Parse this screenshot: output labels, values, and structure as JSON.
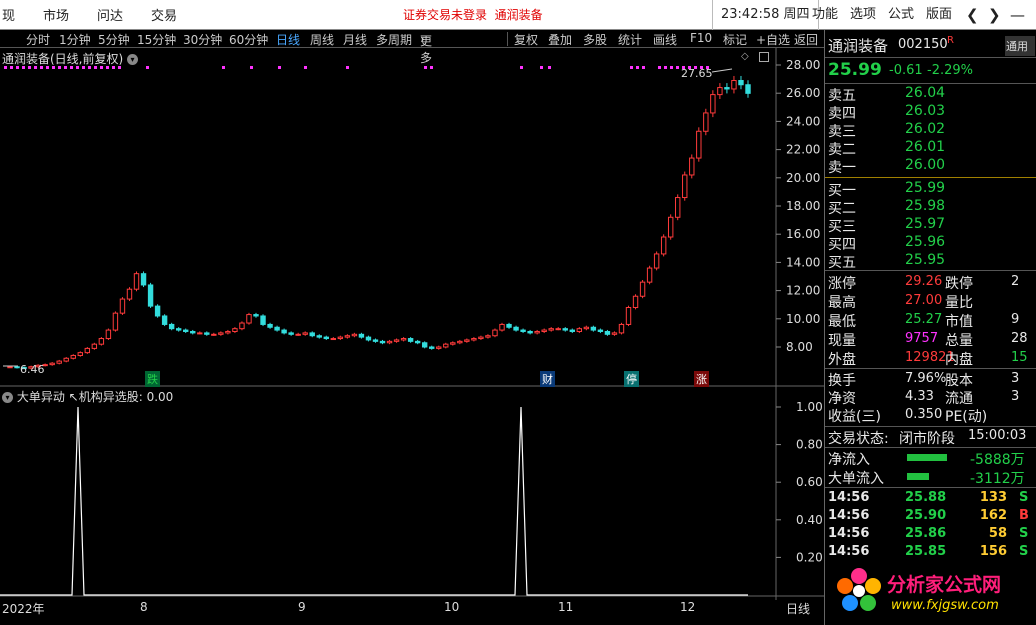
{
  "topbar": {
    "menus": [
      "现",
      "市场",
      "问达",
      "交易"
    ],
    "notice": "证券交易未登录",
    "stock_link": "通润装备",
    "clock": "23:42:58 周四",
    "right_menus": [
      "功能",
      "选项",
      "公式",
      "版面"
    ]
  },
  "toolbar": {
    "periods": [
      "分时",
      "1分钟",
      "5分钟",
      "15分钟",
      "30分钟",
      "60分钟",
      "日线",
      "周线",
      "月线",
      "多周期",
      "更多"
    ],
    "active_period": "日线",
    "tools": [
      "复权",
      "叠加",
      "多股",
      "统计",
      "画线",
      "F10",
      "标记",
      "+自选",
      "返回"
    ]
  },
  "main_chart": {
    "title": "通润装备(日线,前复权)",
    "max_label": "27.65",
    "min_label": "6.46",
    "y_ticks": [
      "28.00",
      "26.00",
      "24.00",
      "22.00",
      "20.00",
      "18.00",
      "16.00",
      "14.00",
      "12.00",
      "10.00",
      "8.00"
    ],
    "event_labels": [
      "跌",
      "财",
      "停",
      "涨"
    ]
  },
  "indicator": {
    "title": "大单异动",
    "subtitle": "↖机构异选股: 0.00",
    "y_ticks": [
      "1.00",
      "0.80",
      "0.60",
      "0.40",
      "0.20"
    ]
  },
  "x_axis": {
    "labels": [
      "2022年",
      "8",
      "9",
      "10",
      "11",
      "12"
    ],
    "period_label": "日线"
  },
  "quote": {
    "name": "通润装备",
    "code": "002150",
    "flag": "R",
    "price": "25.99",
    "change": "-0.61",
    "change_pct": "-2.29%",
    "asks": [
      {
        "label": "卖五",
        "price": "26.04"
      },
      {
        "label": "卖四",
        "price": "26.03"
      },
      {
        "label": "卖三",
        "price": "26.02"
      },
      {
        "label": "卖二",
        "price": "26.01"
      },
      {
        "label": "卖一",
        "price": "26.00"
      }
    ],
    "bids": [
      {
        "label": "买一",
        "price": "25.99"
      },
      {
        "label": "买二",
        "price": "25.98"
      },
      {
        "label": "买三",
        "price": "25.97"
      },
      {
        "label": "买四",
        "price": "25.96"
      },
      {
        "label": "买五",
        "price": "25.95"
      }
    ],
    "stats": [
      {
        "l1": "涨停",
        "v1": "29.26",
        "l2": "跌停",
        "v2": "2"
      },
      {
        "l1": "最高",
        "v1": "27.00",
        "l2": "量比",
        "v2": ""
      },
      {
        "l1": "最低",
        "v1": "25.27",
        "l2": "市值",
        "v2": "9"
      },
      {
        "l1": "现量",
        "v1": "9757",
        "l2": "总量",
        "v2": "28"
      },
      {
        "l1": "外盘",
        "v1": "129821",
        "l2": "内盘",
        "v2": "15"
      }
    ],
    "stats2": [
      {
        "l1": "换手",
        "v1": "7.96%",
        "l2": "股本",
        "v2": "3"
      },
      {
        "l1": "净资",
        "v1": "4.33",
        "l2": "流通",
        "v2": "3"
      },
      {
        "l1": "收益(三)",
        "v1": "0.350",
        "l2": "PE(动)",
        "v2": ""
      }
    ],
    "trade_status_label": "交易状态:",
    "trade_status": "闭市阶段",
    "trade_time": "15:00:03",
    "net_inflow_label": "净流入",
    "net_inflow": "-5888万",
    "big_inflow_label": "大单流入",
    "big_inflow": "-3112万",
    "ticks": [
      {
        "time": "14:56",
        "price": "25.88",
        "vol": "133",
        "side": "S"
      },
      {
        "time": "14:56",
        "price": "25.90",
        "vol": "162",
        "side": "B"
      },
      {
        "time": "14:56",
        "price": "25.86",
        "vol": "58",
        "side": "S"
      },
      {
        "time": "14:56",
        "price": "25.85",
        "vol": "156",
        "side": "S"
      }
    ],
    "side_tab": "通用"
  },
  "watermark": {
    "text": "分析家公式网",
    "url": "www.fxjgsw.com"
  },
  "colors": {
    "up": "#ff3b3b",
    "down": "#22d04a",
    "candle_up": "#ff3b3b",
    "candle_down": "#33dddd",
    "accent": "#4aa8ff"
  }
}
